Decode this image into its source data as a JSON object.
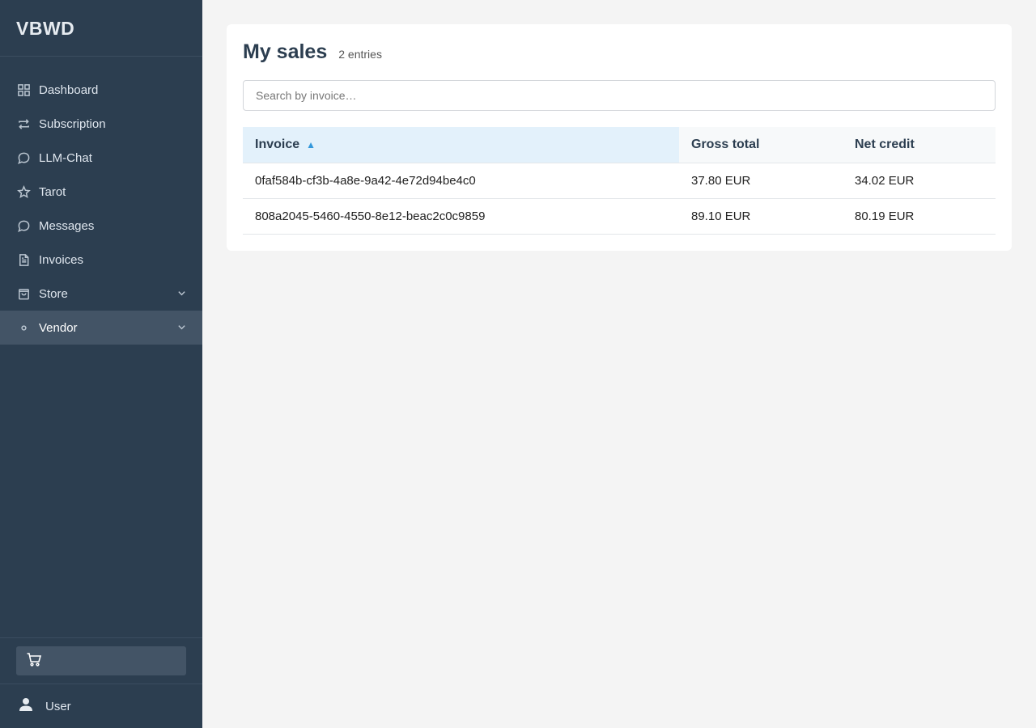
{
  "sidebar": {
    "brand": "VBWD",
    "items": [
      {
        "label": "Dashboard",
        "icon": "grid-icon"
      },
      {
        "label": "Subscription",
        "icon": "repeat-icon"
      },
      {
        "label": "LLM-Chat",
        "icon": "chat-bubble-icon"
      },
      {
        "label": "Tarot",
        "icon": "star-icon"
      },
      {
        "label": "Messages",
        "icon": "chat-bubble-icon"
      },
      {
        "label": "Invoices",
        "icon": "document-icon"
      },
      {
        "label": "Store",
        "icon": "shopping-bag-icon",
        "expandable": true
      },
      {
        "label": "Vendor",
        "icon": "dot-icon",
        "expandable": true,
        "active": true
      }
    ],
    "cart_icon": "cart-icon",
    "user": {
      "label": "User",
      "icon": "user-icon"
    }
  },
  "main": {
    "title": "My sales",
    "entries": "2 entries",
    "search": {
      "placeholder": "Search by invoice…",
      "value": ""
    },
    "table": {
      "headers": {
        "invoice": "Invoice",
        "gross": "Gross total",
        "net": "Net credit"
      },
      "sort_indicator": "▲",
      "rows": [
        {
          "invoice": "0faf584b-cf3b-4a8e-9a42-4e72d94be4c0",
          "gross": "37.80 EUR",
          "net": "34.02 EUR"
        },
        {
          "invoice": "808a2045-5460-4550-8e12-beac2c0c9859",
          "gross": "89.10 EUR",
          "net": "80.19 EUR"
        }
      ]
    }
  },
  "colors": {
    "sidebar_bg": "#2c3e50",
    "active_item_bg": "#435466",
    "sorted_header_bg": "#e3f1fb",
    "sort_arrow": "#3498db"
  }
}
